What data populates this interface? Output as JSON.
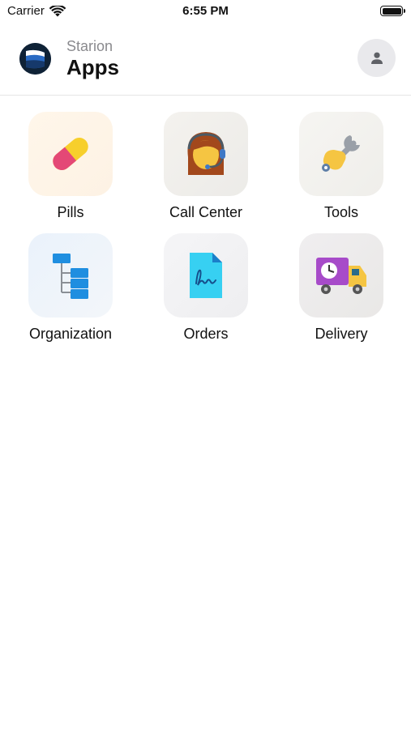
{
  "status_bar": {
    "carrier": "Carrier",
    "time": "6:55 PM",
    "icons": [
      "wifi-icon",
      "battery-icon"
    ]
  },
  "header": {
    "brand": "Starion",
    "title": "Apps",
    "logo_icon": "starion-logo",
    "profile_icon": "person-icon"
  },
  "apps": [
    {
      "label": "Pills",
      "icon": "pill-icon"
    },
    {
      "label": "Call Center",
      "icon": "headset-agent-icon"
    },
    {
      "label": "Tools",
      "icon": "wrench-icon"
    },
    {
      "label": "Organization",
      "icon": "org-chart-icon"
    },
    {
      "label": "Orders",
      "icon": "signed-document-icon"
    },
    {
      "label": "Delivery",
      "icon": "delivery-truck-icon"
    }
  ],
  "colors": {
    "background": "#ffffff",
    "text": "#111111",
    "subtext": "#8a8a8e",
    "divider": "#e6e6e6",
    "profile_button": "#e9e9ec"
  }
}
